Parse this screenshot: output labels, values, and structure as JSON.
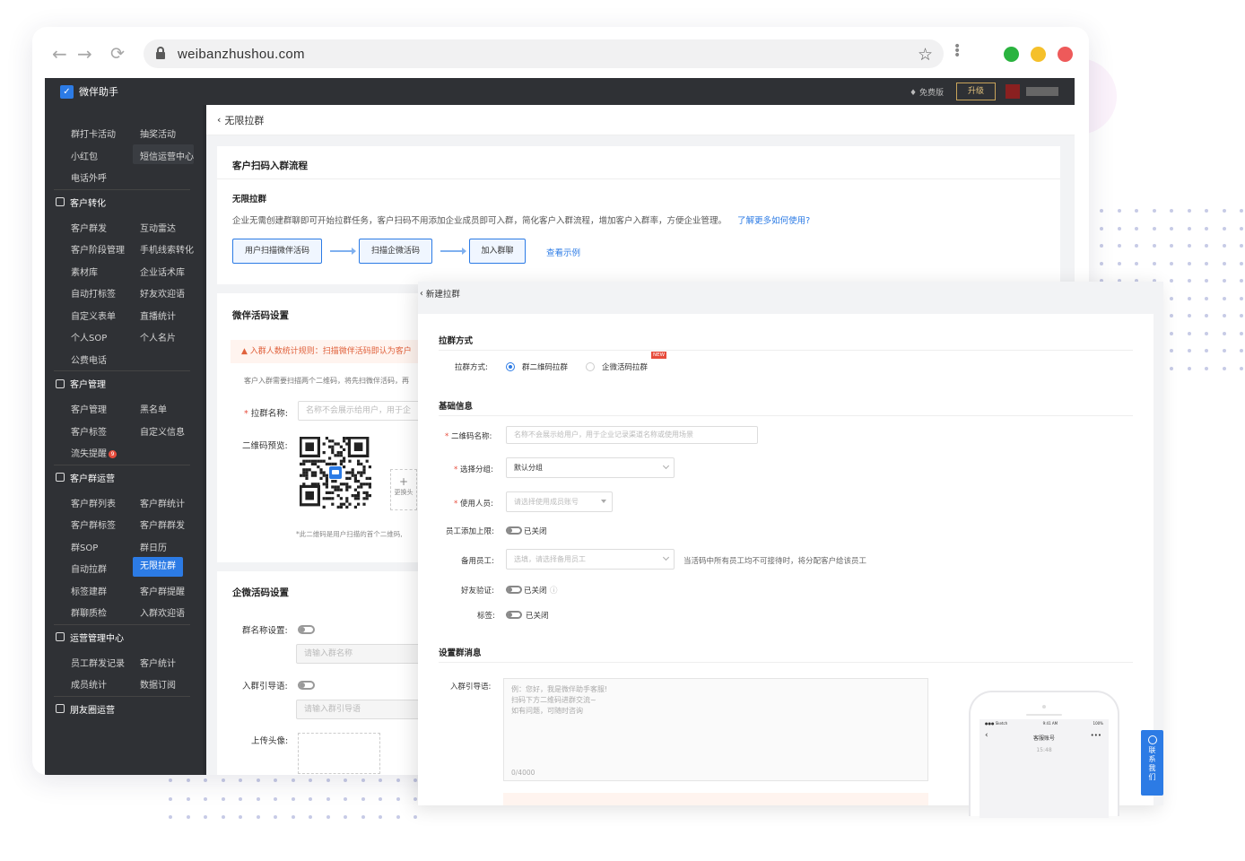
{
  "browser": {
    "url": "weibanzhushou.com",
    "traffic_lights": [
      "#2ab33f",
      "#f5c02a",
      "#ee5a5a"
    ]
  },
  "app": {
    "brand": "微伴助手",
    "free_label": "免费版",
    "upgrade_label": "升级"
  },
  "sidebar": {
    "rows": [
      {
        "c1": "群打卡活动",
        "c2": "抽奖活动"
      },
      {
        "c1": "小红包",
        "c2": "短信运营中心"
      },
      {
        "c1": "电话外呼",
        "c2": ""
      }
    ],
    "sections": [
      {
        "title": "客户转化",
        "rows": [
          {
            "c1": "客户群发",
            "c2": "互动雷达"
          },
          {
            "c1": "客户阶段管理",
            "c2": "手机线索转化"
          },
          {
            "c1": "素材库",
            "c2": "企业话术库"
          },
          {
            "c1": "自动打标签",
            "c2": "好友欢迎语"
          },
          {
            "c1": "自定义表单",
            "c2": "直播统计"
          },
          {
            "c1": "个人SOP",
            "c2": "个人名片"
          },
          {
            "c1": "公费电话",
            "c2": ""
          }
        ]
      },
      {
        "title": "客户管理",
        "rows": [
          {
            "c1": "客户管理",
            "c2": "黑名单"
          },
          {
            "c1": "客户标签",
            "c2": "自定义信息"
          },
          {
            "c1": "流失提醒",
            "c2": ""
          }
        ]
      },
      {
        "title": "客户群运营",
        "rows": [
          {
            "c1": "客户群列表",
            "c2": "客户群统计"
          },
          {
            "c1": "客户群标签",
            "c2": "客户群群发"
          },
          {
            "c1": "群SOP",
            "c2": "群日历"
          },
          {
            "c1": "自动拉群",
            "c2": "无限拉群"
          },
          {
            "c1": "标签建群",
            "c2": "客户群提醒"
          },
          {
            "c1": "群聊质检",
            "c2": "入群欢迎语"
          }
        ]
      },
      {
        "title": "运营管理中心",
        "rows": [
          {
            "c1": "员工群发记录",
            "c2": "客户统计"
          },
          {
            "c1": "成员统计",
            "c2": "数据订阅"
          }
        ]
      },
      {
        "title": "朋友圈运营",
        "rows": []
      }
    ],
    "active_item": "无限拉群",
    "badge": "9"
  },
  "page": {
    "breadcrumb": "无限拉群",
    "flow_card": {
      "title": "客户扫码入群流程",
      "subtitle": "无限拉群",
      "desc": "企业无需创建群聊即可开始拉群任务，客户扫码不用添加企业成员即可入群，简化客户入群流程，增加客户入群率，方便企业管理。",
      "learn_more": "了解更多如何使用?",
      "steps": [
        "用户扫描微伴活码",
        "扫描企微活码",
        "加入群聊"
      ],
      "example_link": "查看示例"
    },
    "weiban_card": {
      "title": "微伴活码设置",
      "warning": "入群人数统计规则：扫描微伴活码即认为客户",
      "note": "客户入群需要扫描两个二维码，将先扫微伴活码，再",
      "name_label": "拉群名称:",
      "name_placeholder": "名称不会展示给用户，用于企",
      "qr_label": "二维码预览:",
      "replace_label": "更换头",
      "qr_note": "*此二维码是用户扫描的首个二维码,"
    },
    "qiwei_card": {
      "title": "企微活码设置",
      "group_name_label": "群名称设置:",
      "group_name_placeholder": "请输入群名称",
      "guide_label": "入群引导语:",
      "guide_placeholder": "请输入群引导语",
      "avatar_label": "上传头像:"
    }
  },
  "modal": {
    "back_label": "新建拉群",
    "method_section": "拉群方式",
    "method_label": "拉群方式:",
    "method_options": [
      "群二维码拉群",
      "企微活码拉群"
    ],
    "new_tag": "NEW",
    "basic_section": "基础信息",
    "qr_name_label": "二维码名称:",
    "qr_name_placeholder": "名称不会展示给用户，用于企业记录渠道名称或使用场景",
    "group_label": "选择分组:",
    "group_value": "默认分组",
    "staff_label": "使用人员:",
    "staff_placeholder": "请选择使用成员账号",
    "limit_label": "员工添加上限:",
    "limit_state": "已关闭",
    "backup_label": "备用员工:",
    "backup_placeholder": "选填，请选择备用员工",
    "backup_hint": "当活码中所有员工均不可接待时，将分配客户给该员工",
    "verify_label": "好友验证:",
    "verify_state": "已关闭",
    "tag_label": "标签:",
    "tag_state": "已关闭",
    "msg_section": "设置群消息",
    "guide_label": "入群引导语:",
    "guide_placeholder": "例：您好，我是微伴助手客服!\n扫码下方二维码进群交流~\n如有问题，可随时咨询",
    "guide_count": "0/4000",
    "phone_title": "客服账号",
    "phone_time": "15:48"
  },
  "contact_button": "联系我们"
}
